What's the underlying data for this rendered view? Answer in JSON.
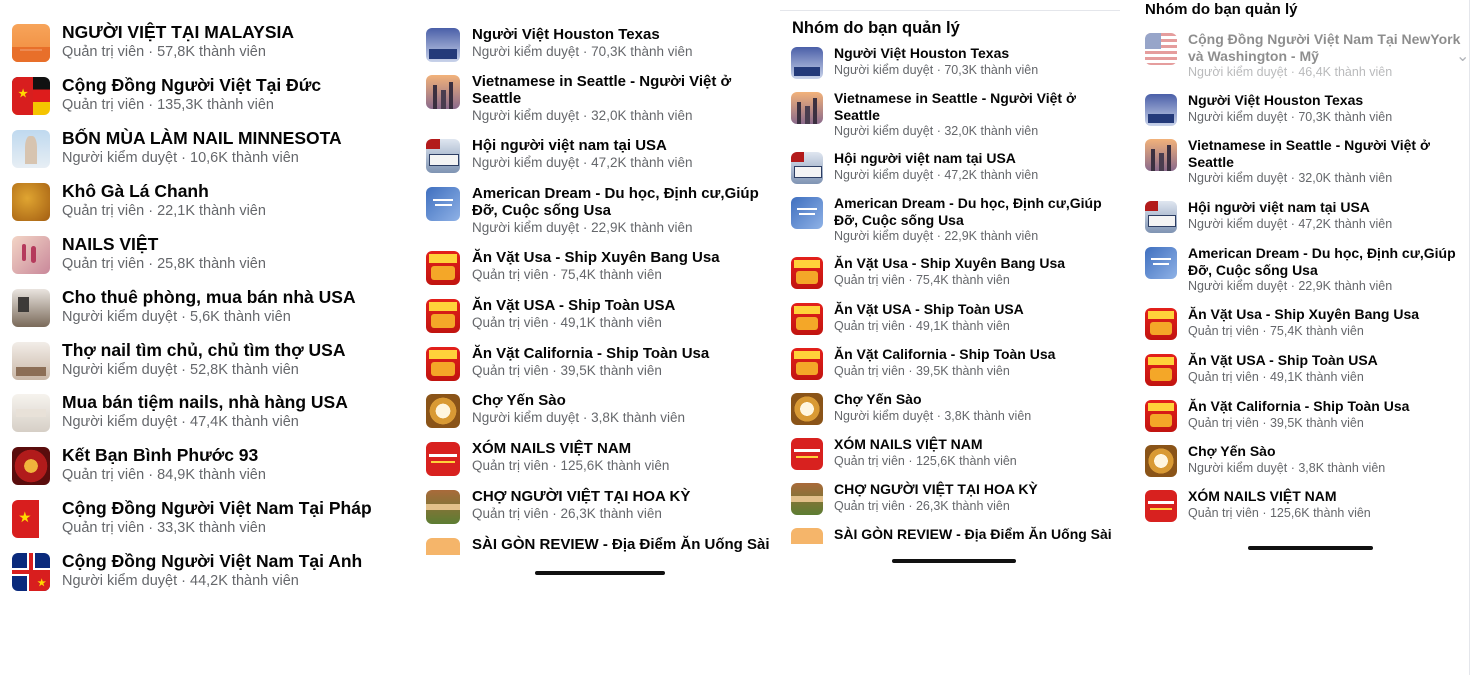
{
  "screenshot_1": {
    "groups": [
      {
        "name": "NGƯỜI VIỆT TẠI MALAYSIA",
        "meta": "Quản trị viên · 57,8K thành viên",
        "icon": "sunset-skyline-thumbnail"
      },
      {
        "name": "Cộng Đồng Người Việt Tại Đức",
        "meta": "Quản trị viên · 135,3K thành viên",
        "icon": "flag-thumbnail"
      },
      {
        "name": "BỐN MÙA LÀM NAIL MINNESOTA",
        "meta": "Người kiểm duyệt · 10,6K thành viên",
        "icon": "landmark-thumbnail"
      },
      {
        "name": "Khô Gà Lá Chanh",
        "meta": "Quản trị viên · 22,1K thành viên",
        "icon": "food-thumbnail"
      },
      {
        "name": "NAILS VIỆT",
        "meta": "Quản trị viên · 25,8K thành viên",
        "icon": "nails-thumbnail"
      },
      {
        "name": "Cho thuê phòng, mua bán nhà USA",
        "meta": "Người kiểm duyệt · 5,6K thành viên",
        "icon": "room-thumbnail"
      },
      {
        "name": "Thợ nail tìm chủ, chủ tìm thợ USA",
        "meta": "Người kiểm duyệt · 52,8K thành viên",
        "icon": "salon-thumbnail"
      },
      {
        "name": "Mua bán tiệm nails, nhà hàng USA",
        "meta": "Người kiểm duyệt · 47,4K thành viên",
        "icon": "salon-interior-thumbnail"
      },
      {
        "name": "Kết Bạn Bình Phước 93",
        "meta": "Quản trị viên · 84,9K thành viên",
        "icon": "red-pattern-thumbnail"
      },
      {
        "name": "Cộng Đồng Người Việt Nam Tại Pháp",
        "meta": "Quản trị viên · 33,3K thành viên",
        "icon": "flag-thumbnail"
      },
      {
        "name": "Cộng Đồng Người Việt Nam Tại Anh",
        "meta": "Người kiểm duyệt · 44,2K thành viên",
        "icon": "flag-thumbnail"
      }
    ]
  },
  "screenshot_2": {
    "groups": [
      {
        "name": "Người Việt Houston Texas",
        "meta": "Người kiểm duyệt · 70,3K thành viên",
        "icon": "houston-thumbnail"
      },
      {
        "name": "Vietnamese in Seattle - Người Việt ở Seattle",
        "meta": "Người kiểm duyệt · 32,0K thành viên",
        "icon": "city-skyline-thumbnail"
      },
      {
        "name": "Hội người việt nam tại USA",
        "meta": "Người kiểm duyệt · 47,2K thành viên",
        "icon": "bus-thumbnail"
      },
      {
        "name": "American Dream - Du học, Định cư,Giúp Đỡ, Cuộc sống Usa",
        "meta": "Người kiểm duyệt · 22,9K thành viên",
        "icon": "hope-logo-thumbnail"
      },
      {
        "name": "Ăn Vặt Usa - Ship Xuyên Bang Usa",
        "meta": "Quản trị viên · 75,4K thành viên",
        "icon": "snack-poster-thumbnail"
      },
      {
        "name": "Ăn Vặt USA - Ship Toàn USA",
        "meta": "Quản trị viên · 49,1K thành viên",
        "icon": "snack-poster-thumbnail"
      },
      {
        "name": "Ăn Vặt California - Ship Toàn Usa",
        "meta": "Quản trị viên · 39,5K thành viên",
        "icon": "snack-poster-thumbnail"
      },
      {
        "name": "Chợ Yến Sào",
        "meta": "Người kiểm duyệt · 3,8K thành viên",
        "icon": "bowl-thumbnail"
      },
      {
        "name": "XÓM NAILS VIỆT NAM",
        "meta": "Quản trị viên · 125,6K thành viên",
        "icon": "red-banner-thumbnail"
      },
      {
        "name": "CHỢ NGƯỜI VIỆT TẠI HOA KỲ",
        "meta": "Quản trị viên · 26,3K thành viên",
        "icon": "market-thumbnail"
      },
      {
        "name": "SÀI GÒN REVIEW - Địa Điểm Ăn Uống Sài",
        "meta": "",
        "icon": "review-thumbnail"
      }
    ]
  },
  "screenshot_3": {
    "header": "Nhóm do bạn quản lý",
    "groups": [
      {
        "name": "Người Việt Houston Texas",
        "meta": "Người kiểm duyệt · 70,3K thành viên",
        "icon": "houston-thumbnail"
      },
      {
        "name": "Vietnamese in Seattle - Người Việt ở Seattle",
        "meta": "Người kiểm duyệt · 32,0K thành viên",
        "icon": "city-skyline-thumbnail"
      },
      {
        "name": "Hội người việt nam tại USA",
        "meta": "Người kiểm duyệt · 47,2K thành viên",
        "icon": "bus-thumbnail"
      },
      {
        "name": "American Dream - Du học, Định cư,Giúp Đỡ, Cuộc sống Usa",
        "meta": "Người kiểm duyệt · 22,9K thành viên",
        "icon": "hope-logo-thumbnail"
      },
      {
        "name": "Ăn Vặt Usa - Ship Xuyên Bang Usa",
        "meta": "Quản trị viên · 75,4K thành viên",
        "icon": "snack-poster-thumbnail"
      },
      {
        "name": "Ăn Vặt USA - Ship Toàn USA",
        "meta": "Quản trị viên · 49,1K thành viên",
        "icon": "snack-poster-thumbnail"
      },
      {
        "name": "Ăn Vặt California - Ship Toàn Usa",
        "meta": "Quản trị viên · 39,5K thành viên",
        "icon": "snack-poster-thumbnail"
      },
      {
        "name": "Chợ Yến Sào",
        "meta": "Người kiểm duyệt · 3,8K thành viên",
        "icon": "bowl-thumbnail"
      },
      {
        "name": "XÓM NAILS VIỆT NAM",
        "meta": "Quản trị viên · 125,6K thành viên",
        "icon": "red-banner-thumbnail"
      },
      {
        "name": "CHỢ NGƯỜI VIỆT TẠI HOA KỲ",
        "meta": "Quản trị viên · 26,3K thành viên",
        "icon": "market-thumbnail"
      },
      {
        "name": "SÀI GÒN REVIEW - Địa Điểm Ăn Uống Sài",
        "meta": "",
        "icon": "review-thumbnail"
      }
    ]
  },
  "screenshot_4": {
    "header": "Nhóm do bạn quản lý",
    "groups": [
      {
        "name": "Cộng Đồng Người Việt Nam Tại NewYork và Washington - Mỹ",
        "meta": "Người kiểm duyệt · 46,4K thành viên",
        "icon": "us-flag-thumbnail",
        "faded": true
      },
      {
        "name": "Người Việt Houston Texas",
        "meta": "Người kiểm duyệt · 70,3K thành viên",
        "icon": "houston-thumbnail"
      },
      {
        "name": "Vietnamese in Seattle - Người Việt ở Seattle",
        "meta": "Người kiểm duyệt · 32,0K thành viên",
        "icon": "city-skyline-thumbnail"
      },
      {
        "name": "Hội người việt nam tại USA",
        "meta": "Người kiểm duyệt · 47,2K thành viên",
        "icon": "bus-thumbnail"
      },
      {
        "name": "American Dream - Du học, Định cư,Giúp Đỡ, Cuộc sống Usa",
        "meta": "Người kiểm duyệt · 22,9K thành viên",
        "icon": "hope-logo-thumbnail"
      },
      {
        "name": "Ăn Vặt Usa - Ship Xuyên Bang Usa",
        "meta": "Quản trị viên · 75,4K thành viên",
        "icon": "snack-poster-thumbnail"
      },
      {
        "name": "Ăn Vặt USA - Ship Toàn USA",
        "meta": "Quản trị viên · 49,1K thành viên",
        "icon": "snack-poster-thumbnail"
      },
      {
        "name": "Ăn Vặt California - Ship Toàn Usa",
        "meta": "Quản trị viên · 39,5K thành viên",
        "icon": "snack-poster-thumbnail"
      },
      {
        "name": "Chợ Yến Sào",
        "meta": "Người kiểm duyệt · 3,8K thành viên",
        "icon": "bowl-thumbnail"
      },
      {
        "name": "XÓM NAILS VIỆT NAM",
        "meta": "Quản trị viên · 125,6K thành viên",
        "icon": "red-banner-thumbnail"
      }
    ]
  }
}
